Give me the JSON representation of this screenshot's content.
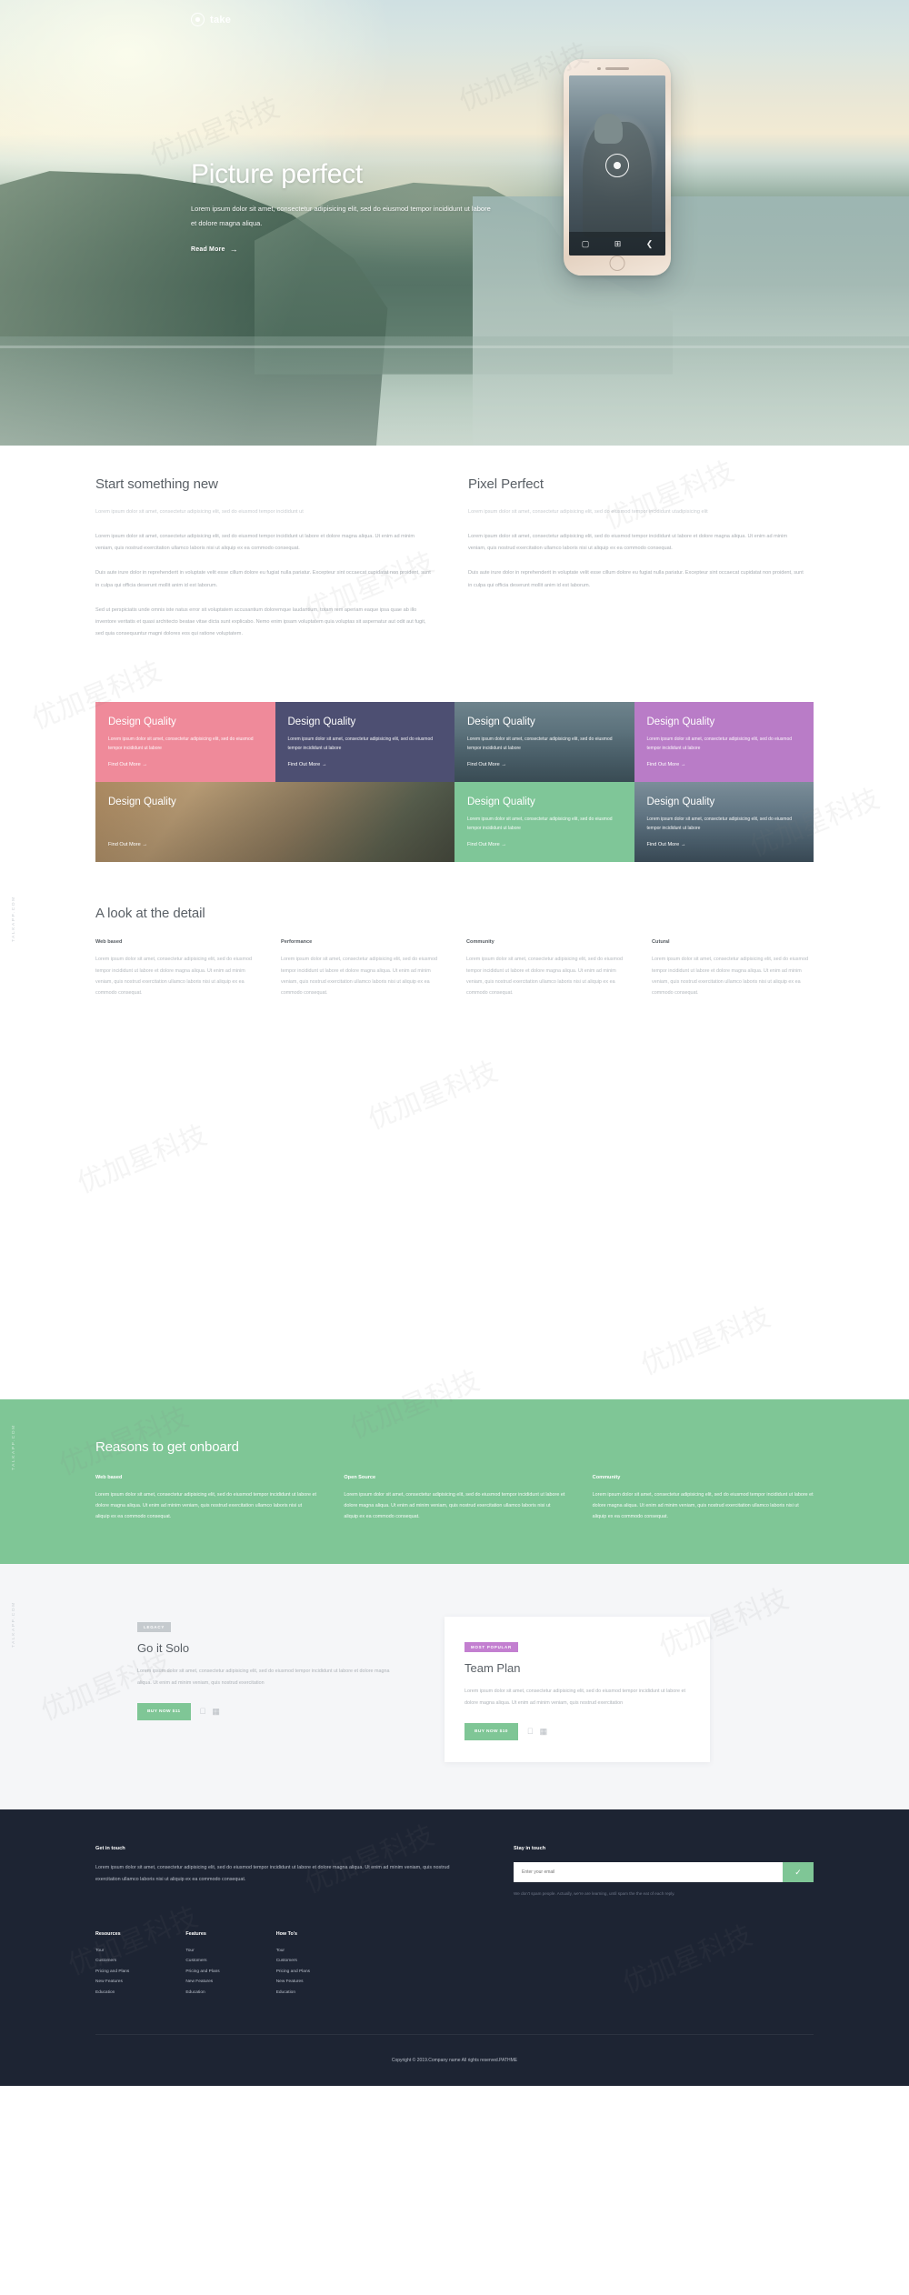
{
  "brand": {
    "name": "take",
    "logo_icon": "camera-circle-icon"
  },
  "hero": {
    "title": "Picture perfect",
    "subtitle": "Lorem ipsum dolor sit amet, consectetur adipisicing elit, sed do eiusmod tempor incididunt ut labore et dolore magna aliqua.",
    "cta": "Read More",
    "cta_arrow": "→",
    "phone": {
      "shutter_icon": "shutter-icon",
      "toolbar": [
        {
          "icon": "camera-icon",
          "glyph": "▢"
        },
        {
          "icon": "grid-icon",
          "glyph": "⊞"
        },
        {
          "icon": "share-icon",
          "glyph": "❮"
        }
      ]
    }
  },
  "intro": {
    "columns": [
      {
        "heading": "Start something new",
        "lead": "Lorem ipsum dolor sit amet, consectetur adipisicing elit, sed do eiusmod tempor incididunt ut",
        "paragraphs": [
          "Lorem ipsum dolor sit amet, consectetur adipisicing elit, sed do eiusmod tempor incididunt ut labore et dolore magna aliqua. Ut enim ad minim veniam, quis nostrud exercitation ullamco laboris nisi ut aliquip ex ea commodo consequat.",
          "Duis aute irure dolor in reprehenderit in voluptate velit esse cillum dolore eu fugiat nulla pariatur. Excepteur sint occaecat cupidatat non proident, sunt in culpa qui officia deserunt mollit anim id est laborum.",
          "Sed ut perspiciatis unde omnis iste natus error sit voluptatem accusantium doloremque laudantium, totam rem aperiam eaque ipsa quae ab illo inventore veritatis et quasi architecto beatae vitae dicta sunt explicabo. Nemo enim ipsam voluptatem quia voluptas sit aspernatur aut odit aut fugit, sed quia consequuntur magni dolores eos qui ratione voluptatem."
        ]
      },
      {
        "heading": "Pixel Perfect",
        "lead": "Lorem ipsum dolor sit amet, consectetur adipisicing elit, sed do eiusmod tempor incididunt utadipisicing elit",
        "paragraphs": [
          "Lorem ipsum dolor sit amet, consectetur adipisicing elit, sed do eiusmod tempor incididunt ut labore et dolore magna aliqua. Ut enim ad minim veniam, quis nostrud exercitation ullamco laboris nisi ut aliquip ex ea commodo consequat.",
          "Duis aute irure dolor in reprehenderit in voluptate velit esse cillum dolore eu fugiat nulla pariatur. Excepteur sint occaecat cupidatat non proident, sunt in culpa qui officia deserunt mollit anim id est laborum."
        ]
      }
    ]
  },
  "grid": {
    "card_title": "Design Quality",
    "card_desc": "Lorem ipsum dolor sit amet, consectetur adipisicing elit, sed do eiusmod tempor incididunt ut labore",
    "card_link": "Find Out More",
    "link_arrow": "→",
    "cards": [
      {
        "style": "c-pink",
        "title": "Design Quality",
        "has_text": true
      },
      {
        "style": "c-navy",
        "title": "Design Quality",
        "has_text": true
      },
      {
        "style": "c-photo-a",
        "title": "Design Quality",
        "has_text": true
      },
      {
        "style": "c-purple",
        "title": "Design Quality",
        "has_text": true
      },
      {
        "style": "c-photo-b",
        "title": "Design Quality",
        "has_text": false
      },
      {
        "style": "c-photo-b",
        "title": "Design Quality",
        "has_text": false
      },
      {
        "style": "c-green",
        "title": "Design Quality",
        "has_text": true
      },
      {
        "style": "c-photo-c",
        "title": "Design Quality",
        "has_text": true
      }
    ],
    "colors": {
      "pink": "#ef8a9a",
      "navy": "#4d4f72",
      "purple": "#b97cc7",
      "green": "#7fc698",
      "blue": "#6f8fa8"
    }
  },
  "detail": {
    "vertical_label": "TALKAPP.COM",
    "heading": "A look at the detail",
    "columns": [
      {
        "head": "Web based",
        "body": "Lorem ipsum dolor sit amet, consectetur adipisicing elit, sed do eiusmod tempor incididunt ut labore et dolore magna aliqua. Ut enim ad minim veniam, quis nostrud exercitation ullamco laboris nisi ut aliquip ex ea commodo consequat."
      },
      {
        "head": "Performance",
        "body": "Lorem ipsum dolor sit amet, consectetur adipisicing elit, sed do eiusmod tempor incididunt ut labore et dolore magna aliqua. Ut enim ad minim veniam, quis nostrud exercitation ullamco laboris nisi ut aliquip ex ea commodo consequat."
      },
      {
        "head": "Community",
        "body": "Lorem ipsum dolor sit amet, consectetur adipisicing elit, sed do eiusmod tempor incididunt ut labore et dolore magna aliqua. Ut enim ad minim veniam, quis nostrud exercitation ullamco laboris nisi ut aliquip ex ea commodo consequat."
      },
      {
        "head": "Cutural",
        "body": "Lorem ipsum dolor sit amet, consectetur adipisicing elit, sed do eiusmod tempor incididunt ut labore et dolore magna aliqua. Ut enim ad minim veniam, quis nostrud exercitation ullamco laboris nisi ut aliquip ex ea commodo consequat."
      }
    ]
  },
  "onboard": {
    "vertical_label": "TALKAPP.COM",
    "heading": "Reasons to get onboard",
    "bg_color": "#7fc696",
    "columns": [
      {
        "head": "Web based",
        "body": "Lorem ipsum dolor sit amet, consectetur adipisicing elit, sed do eiusmod tempor incididunt ut labore et dolore magna aliqua. Ut enim ad minim veniam, quis nostrud exercitation ullamco laboris nisi ut aliquip ex ea commodo consequat."
      },
      {
        "head": "Open Source",
        "body": "Lorem ipsum dolor sit amet, consectetur adipisicing elit, sed do eiusmod tempor incididunt ut labore et dolore magna aliqua. Ut enim ad minim veniam, quis nostrud exercitation ullamco laboris nisi ut aliquip ex ea commodo consequat."
      },
      {
        "head": "Community",
        "body": "Lorem ipsum dolor sit amet, consectetur adipisicing elit, sed do eiusmod tempor incididunt ut labore et dolore magna aliqua. Ut enim ad minim veniam, quis nostrud exercitation ullamco laboris nisi ut aliquip ex ea commodo consequat."
      }
    ]
  },
  "pricing": {
    "vertical_label": "TALKAPP.COM",
    "plans": [
      {
        "badge": "LEGACY",
        "title": "Go it Solo",
        "body": "Lorem ipsum dolor sit amet, consectetur adipisicing elit, sed do eiusmod tempor incididunt ut labore et dolore magna aliqua. Ut enim ad minim veniam, quis nostrud exercitation",
        "button": "BUY NOW $11",
        "os": [
          "apple-icon",
          "windows-icon"
        ]
      },
      {
        "badge": "MOST POPULAR",
        "title": "Team Plan",
        "body": "Lorem ipsum dolor sit amet, consectetur adipisicing elit, sed do eiusmod tempor incididunt ut labore et dolore magna aliqua. Ut enim ad minim veniam, quis nostrud exercitation",
        "button": "BUY NOW $10",
        "os": [
          "apple-icon",
          "windows-icon"
        ]
      }
    ]
  },
  "footer": {
    "get_in_touch": {
      "head": "Get in touch",
      "body": "Lorem ipsum dolor sit amet, consectetur adipisicing elit, sed do eiusmod tempor incididunt ut labore et dolore magna aliqua. Ut enim ad minim veniam, quis nostrud exercitation ullamco laboris nisi ut aliquip ex ea commodo consequat."
    },
    "stay_in_touch": {
      "head": "Stay in touch",
      "placeholder": "Enter your email",
      "submit_icon": "check-icon",
      "note": "We don't spam people. Actually, we're are learning, until spam the the eat of each reply."
    },
    "link_columns": [
      {
        "head": "Resources",
        "links": [
          "Tour",
          "Customers",
          "Pricing and Plans",
          "New Features",
          "Education"
        ]
      },
      {
        "head": "Features",
        "links": [
          "Tour",
          "Customers",
          "Pricing and Plans",
          "New Features",
          "Education"
        ]
      },
      {
        "head": "How To's",
        "links": [
          "Tour",
          "Customers",
          "Pricing and Plans",
          "New Features",
          "Education"
        ]
      }
    ],
    "copyright": "Copyright © 2019.Company name All rights reserved.",
    "copyright_accent": "PATHME",
    "accent_color": "#7fc696"
  },
  "watermarks": [
    "优加星科技"
  ]
}
